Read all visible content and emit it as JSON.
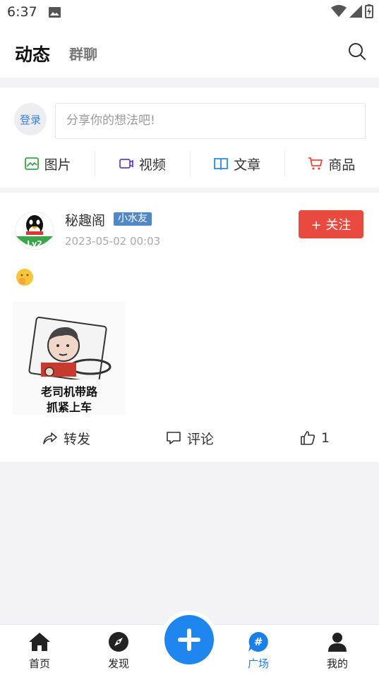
{
  "status_bar": {
    "time": "6:37"
  },
  "header": {
    "tabs": [
      {
        "label": "动态"
      },
      {
        "label": "群聊"
      }
    ]
  },
  "composer": {
    "login_label": "登录",
    "placeholder": "分享你的想法吧!",
    "actions": [
      {
        "label": "图片",
        "icon": "image-icon",
        "color": "#3aa64a"
      },
      {
        "label": "视频",
        "icon": "video-icon",
        "color": "#6a42c4"
      },
      {
        "label": "文章",
        "icon": "book-icon",
        "color": "#2a8de0"
      },
      {
        "label": "商品",
        "icon": "cart-icon",
        "color": "#e84a3f"
      }
    ]
  },
  "post": {
    "author": "秘趣阁",
    "badge": "小水友",
    "time": "2023-05-02 00:03",
    "level": "Lv2",
    "follow_label": "+ 关注",
    "image_caption_line1": "老司机带路",
    "image_caption_line2": "抓紧上车",
    "actions": {
      "share": "转发",
      "comment": "评论",
      "like_count": "1"
    }
  },
  "bottom_nav": {
    "items": [
      {
        "label": "首页",
        "icon": "home-icon"
      },
      {
        "label": "发现",
        "icon": "compass-icon"
      },
      {
        "label": "广场",
        "icon": "hashtag-icon",
        "active": true
      },
      {
        "label": "我的",
        "icon": "user-icon"
      }
    ],
    "fab_icon": "plus-icon",
    "accent": "#1f86ef"
  }
}
